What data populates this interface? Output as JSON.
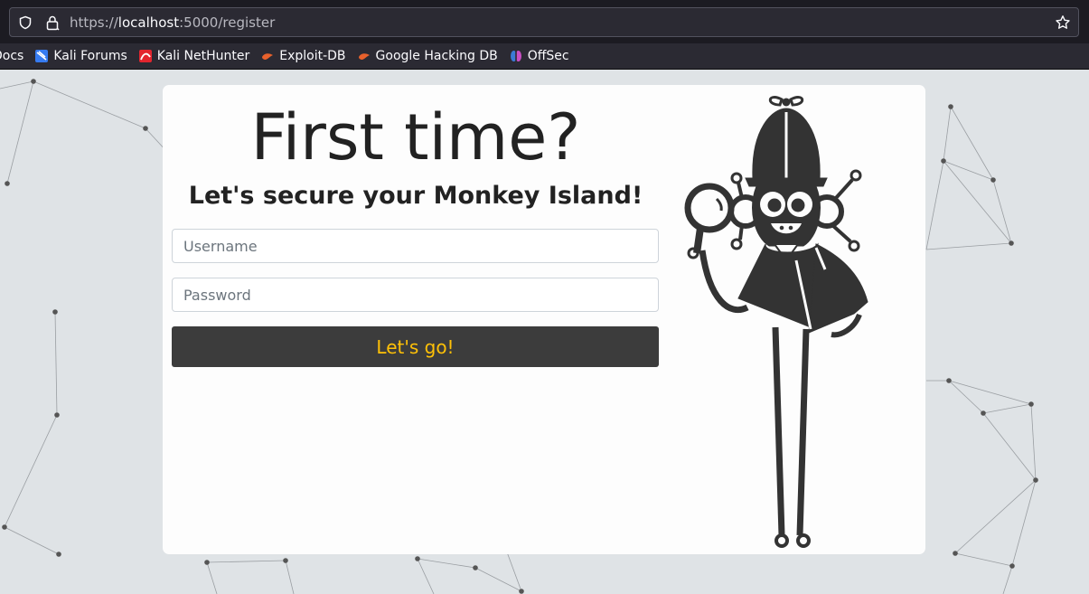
{
  "browser": {
    "url_prefix": "https://",
    "url_host": "localhost",
    "url_rest": ":5000/register",
    "bookmarks": [
      {
        "label": "Docs"
      },
      {
        "label": "Kali Forums"
      },
      {
        "label": "Kali NetHunter"
      },
      {
        "label": "Exploit-DB"
      },
      {
        "label": "Google Hacking DB"
      },
      {
        "label": "OffSec"
      }
    ]
  },
  "register": {
    "title": "First time?",
    "subtitle": "Let's secure your Monkey Island!",
    "username_placeholder": "Username",
    "password_placeholder": "Password",
    "submit_label": "Let's go!"
  },
  "colors": {
    "accent": "#ffc107",
    "button_bg": "#3c3c3c",
    "page_bg": "#dfe3e6"
  },
  "icons": {
    "shield": "shield-icon",
    "lock": "lock-icon",
    "star": "bookmark-star-icon",
    "mascot": "monkey-detective-mascot"
  }
}
